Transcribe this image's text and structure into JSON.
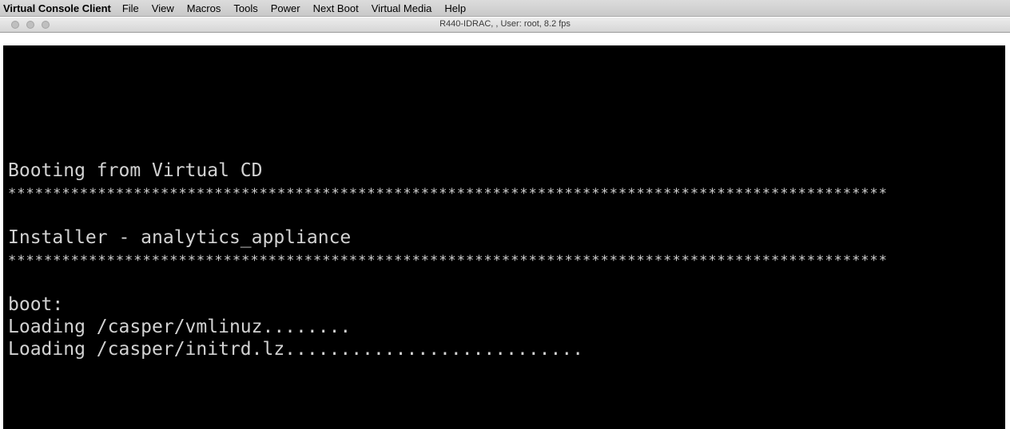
{
  "menubar": {
    "app_name": "Virtual Console Client",
    "items": [
      "File",
      "View",
      "Macros",
      "Tools",
      "Power",
      "Next Boot",
      "Virtual Media",
      "Help"
    ]
  },
  "window": {
    "title": "R440-IDRAC,  , User: root, 8.2 fps"
  },
  "console": {
    "lines": {
      "booting": "Booting from Virtual CD",
      "stars1": "**************************************************************************************************",
      "installer": "Installer - analytics_appliance",
      "stars2": "**************************************************************************************************",
      "boot_prompt": "boot:",
      "loading_vmlinuz": "Loading /casper/vmlinuz........",
      "loading_initrd": "Loading /casper/initrd.lz..........................."
    }
  },
  "colors": {
    "console_bg": "#000000",
    "console_text": "#d2d2d2",
    "menubar_bg": "#d0d0d0"
  }
}
